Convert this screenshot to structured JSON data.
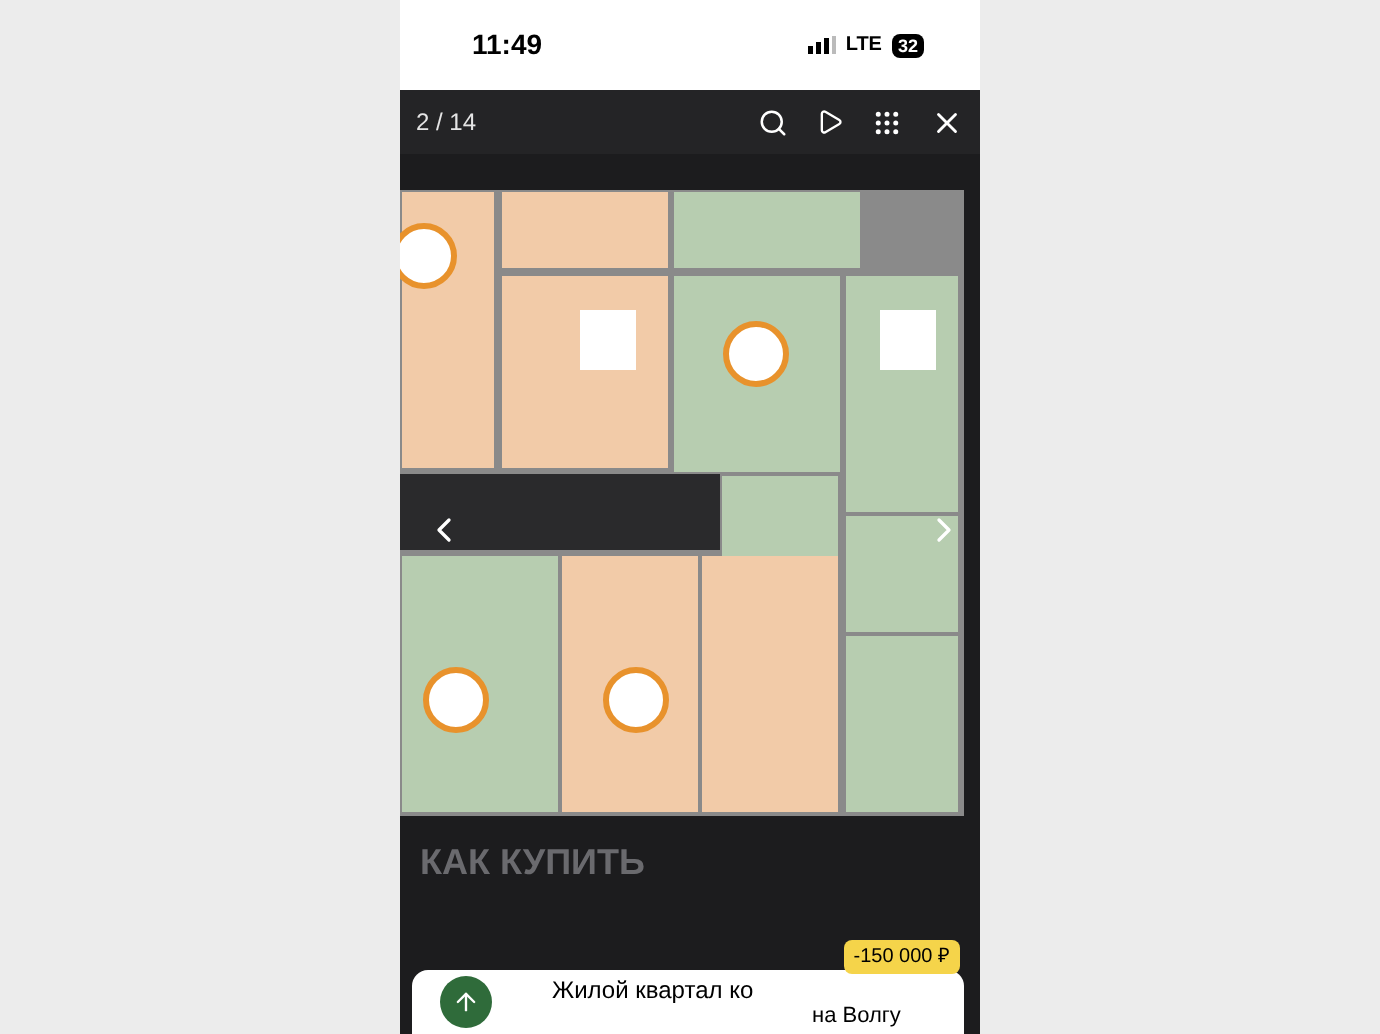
{
  "status_bar": {
    "time": "11:49",
    "network": "LTE",
    "battery": "32"
  },
  "viewer": {
    "counter": "2 / 14"
  },
  "page": {
    "heading": "КАК КУПИТЬ"
  },
  "promo": {
    "title": "Жилой квартал ко",
    "subtitle": "на Волгу",
    "discount": "-150 000 ₽"
  }
}
